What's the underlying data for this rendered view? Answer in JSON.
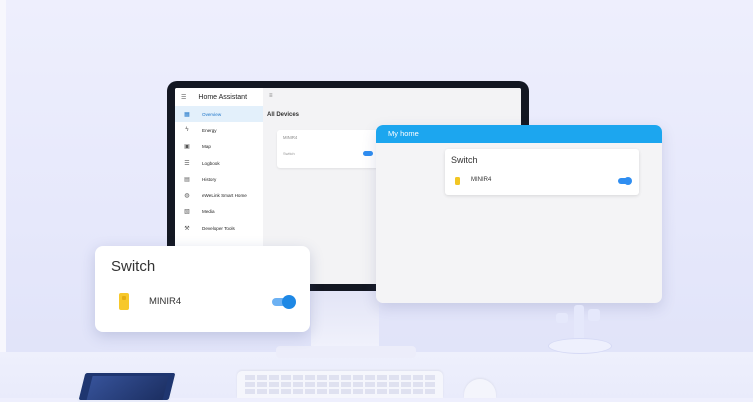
{
  "ha": {
    "app_title": "Home Assistant",
    "sidebar_items": [
      {
        "label": "Overview",
        "icon": "grid-icon",
        "glyph": "▦",
        "active": true
      },
      {
        "label": "Energy",
        "icon": "lightning-icon",
        "glyph": "ϟ"
      },
      {
        "label": "Map",
        "icon": "map-icon",
        "glyph": "▣"
      },
      {
        "label": "Logbook",
        "icon": "list-icon",
        "glyph": "☰"
      },
      {
        "label": "History",
        "icon": "chart-icon",
        "glyph": "▤"
      },
      {
        "label": "eWeLink Smart Home",
        "icon": "globe-icon",
        "glyph": "◍"
      },
      {
        "label": "Media",
        "icon": "media-icon",
        "glyph": "▧"
      },
      {
        "label": "Developer Tools",
        "icon": "wrench-icon",
        "glyph": "⚒"
      }
    ],
    "main_heading": "All Devices",
    "mini_card_title": "MINIR4",
    "mini_card_device": "Switch"
  },
  "my_home": {
    "header": "My home",
    "card_title": "Switch",
    "device_name": "MINIR4",
    "toggle_on": true
  },
  "switch_card": {
    "title": "Switch",
    "device_name": "MINIR4",
    "toggle_on": true
  },
  "colors": {
    "accent": "#1ca6ef",
    "toggle": "#1e88e5",
    "device_icon": "#f7c82b"
  }
}
